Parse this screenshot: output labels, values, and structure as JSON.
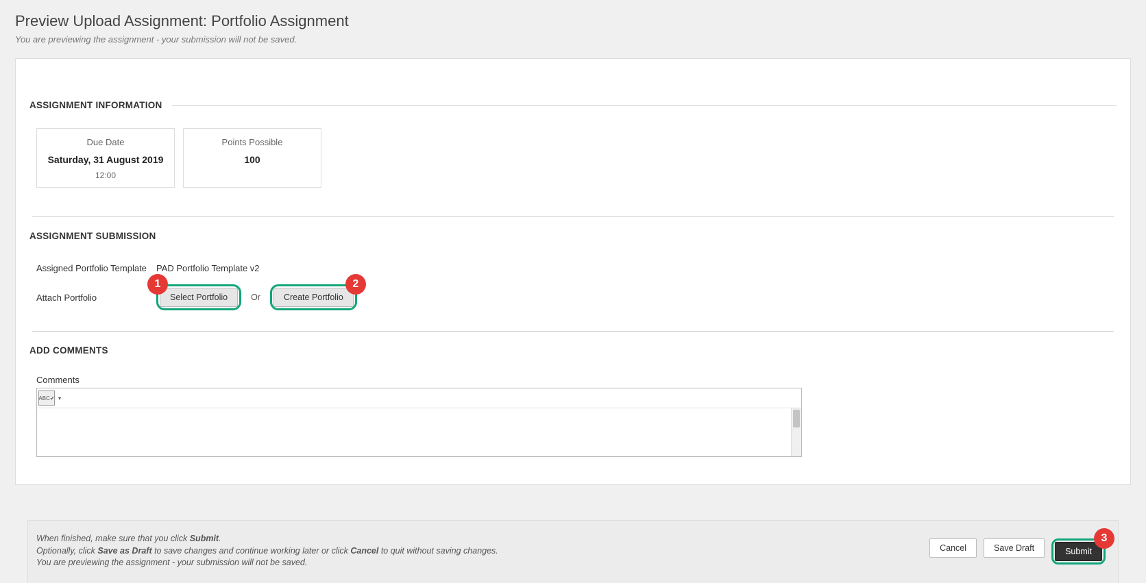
{
  "header": {
    "title": "Preview Upload Assignment: Portfolio Assignment",
    "subtitle": "You are previewing the assignment - your submission will not be saved."
  },
  "sections": {
    "info_heading": "ASSIGNMENT INFORMATION",
    "submission_heading": "ASSIGNMENT SUBMISSION",
    "comments_heading": "ADD COMMENTS"
  },
  "info": {
    "due_label": "Due Date",
    "due_value": "Saturday, 31 August 2019",
    "due_time": "12:00",
    "points_label": "Points Possible",
    "points_value": "100"
  },
  "submission": {
    "template_label": "Assigned Portfolio Template",
    "template_value": "PAD Portfolio Template v2",
    "attach_label": "Attach Portfolio",
    "select_button": "Select Portfolio",
    "or_text": "Or",
    "create_button": "Create Portfolio"
  },
  "comments": {
    "label": "Comments",
    "toolbar_icon": "ABC✔"
  },
  "callouts": {
    "one": "1",
    "two": "2",
    "three": "3"
  },
  "footer": {
    "line1_a": "When finished, make sure that you click ",
    "line1_b": "Submit",
    "line1_c": ".",
    "line2_a": "Optionally, click ",
    "line2_b": "Save as Draft",
    "line2_c": " to save changes and continue working later or click ",
    "line2_d": "Cancel",
    "line2_e": " to quit without saving changes.",
    "line3": "You are previewing the assignment - your submission will not be saved.",
    "cancel": "Cancel",
    "save_draft": "Save Draft",
    "submit": "Submit"
  }
}
